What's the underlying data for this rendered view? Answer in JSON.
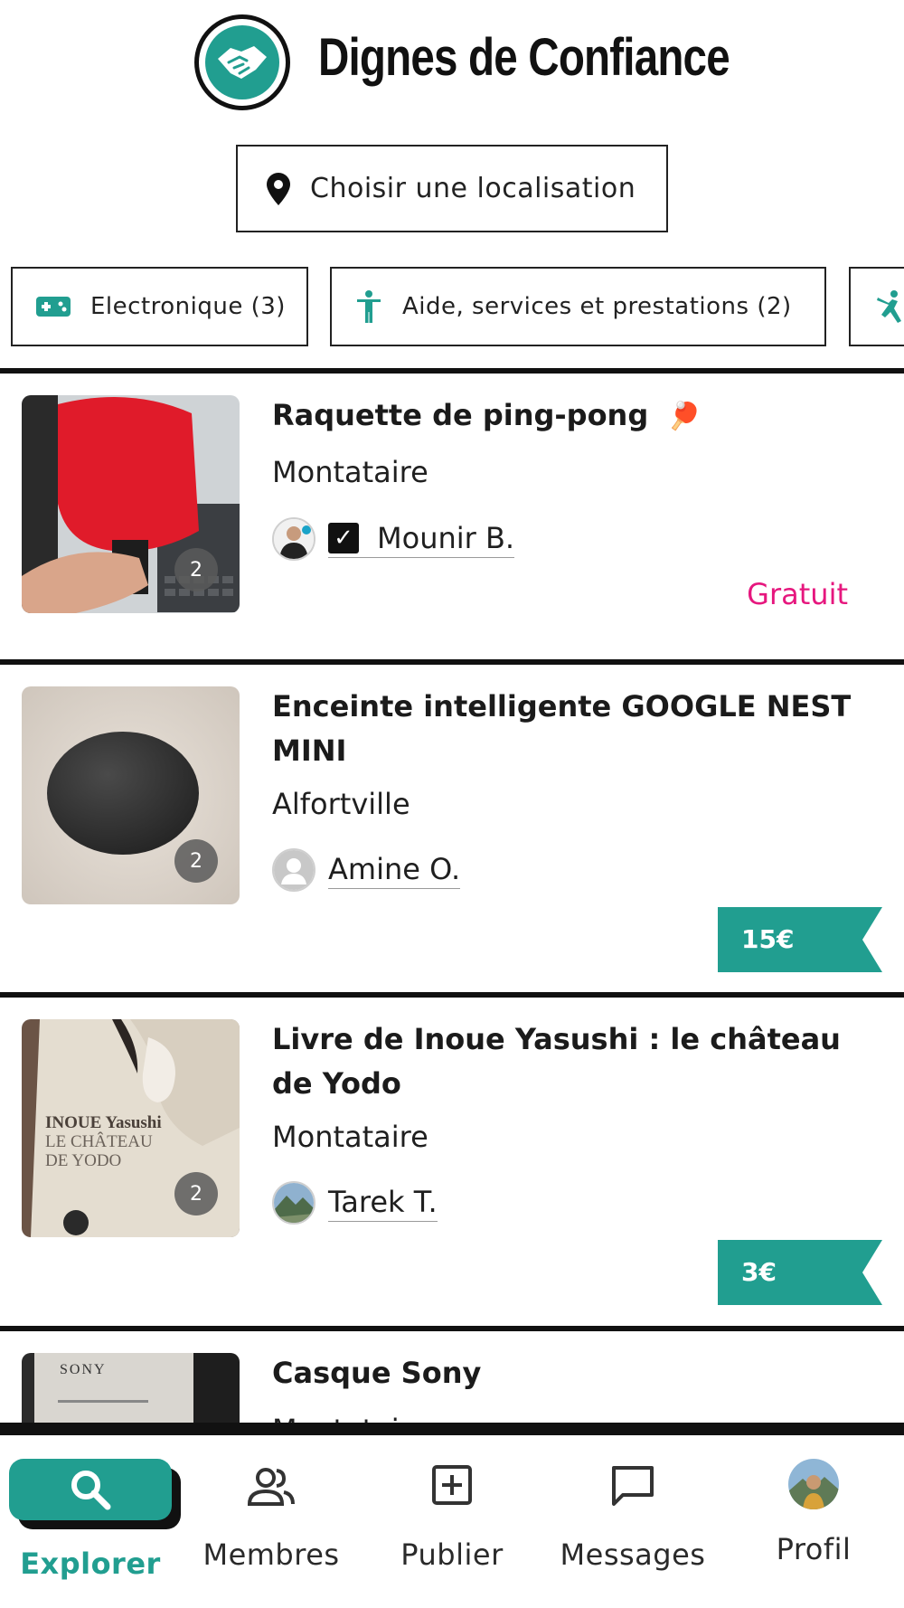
{
  "header": {
    "brand": "Dignes de Confiance",
    "location_button": "Choisir une localisation"
  },
  "categories": [
    {
      "label": "Electronique (3)",
      "icon": "gamepad-icon"
    },
    {
      "label": "Aide, services et prestations (2)",
      "icon": "person-icon"
    },
    {
      "label": "",
      "icon": "karate-icon"
    }
  ],
  "listings": [
    {
      "title": "Raquette de ping-pong",
      "emoji": "🏓",
      "city": "Montataire",
      "author": "Mounir B.",
      "verified": true,
      "photos": "2",
      "price": "Gratuit"
    },
    {
      "title": "Enceinte intelligente GOOGLE NEST MINI",
      "city": "Alfortville",
      "author": "Amine O.",
      "photos": "2",
      "price": "15€"
    },
    {
      "title": "Livre de Inoue Yasushi : le château de Yodo",
      "city": "Montataire",
      "author": "Tarek T.",
      "photos": "2",
      "price": "3€",
      "cover_text": [
        "INOUE Yasushi",
        "LE CHÂTEAU",
        "DE YODO"
      ]
    },
    {
      "title": "Casque Sony",
      "city": "Montataire",
      "box_text": "SONY"
    }
  ],
  "nav": {
    "explore": "Explorer",
    "members": "Membres",
    "publish": "Publier",
    "messages": "Messages",
    "profile": "Profil"
  },
  "colors": {
    "accent": "#219e90",
    "free": "#e6177e",
    "text": "#1b1b1b"
  }
}
